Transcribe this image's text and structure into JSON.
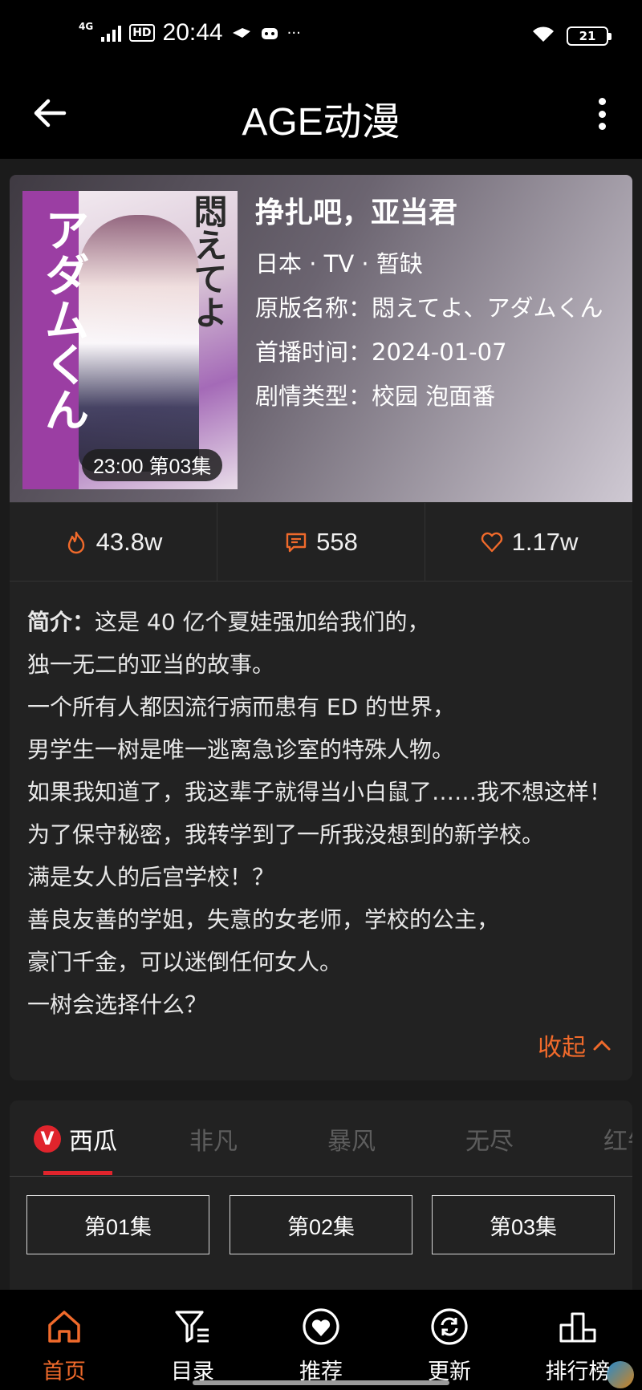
{
  "status_bar": {
    "network": "4G",
    "hd": "HD",
    "time": "20:44",
    "extras": "···",
    "battery": "21"
  },
  "appbar": {
    "title": "AGE动漫"
  },
  "anime": {
    "title": "挣扎吧，亚当君",
    "meta_line": "日本 · TV · 暂缺",
    "original_name_line": "原版名称：悶えてよ、アダムくん",
    "air_date_line": "首播时间：2024-01-07",
    "genre_line": "剧情类型：校园 泡面番",
    "cover": {
      "vertical_title_1": "アダムくん",
      "vertical_title_2": "悶えてよ",
      "episode_pill": "23:00 第03集"
    }
  },
  "stats": {
    "views": "43.8w",
    "comments": "558",
    "likes": "1.17w"
  },
  "synopsis": {
    "label": "简介：",
    "text": "这是 40 亿个夏娃强加给我们的，\n独一无二的亚当的故事。\n一个所有人都因流行病而患有 ED 的世界，\n男学生一树是唯一逃离急诊室的特殊人物。\n如果我知道了，我这辈子就得当小白鼠了……我不想这样！\n为了保守秘密，我转学到了一所我没想到的新学校。\n满是女人的后宫学校！？\n善良友善的学姐，失意的女老师，学校的公主，\n豪门千金，可以迷倒任何女人。\n一树会选择什么？",
    "collapse_label": "收起"
  },
  "sources": {
    "badge": "V",
    "tabs": [
      "西瓜",
      "非凡",
      "暴风",
      "无尽",
      "红牛"
    ]
  },
  "episodes": [
    "第01集",
    "第02集",
    "第03集"
  ],
  "bottom_nav": [
    {
      "label": "首页",
      "icon": "home-icon",
      "active": true
    },
    {
      "label": "目录",
      "icon": "filter-list-icon"
    },
    {
      "label": "推荐",
      "icon": "heart-circle-icon"
    },
    {
      "label": "更新",
      "icon": "refresh-icon"
    },
    {
      "label": "排行榜",
      "icon": "podium-icon"
    }
  ],
  "watermark": "",
  "colors": {
    "accent": "#f06a2b",
    "source_red": "#e0242c"
  }
}
